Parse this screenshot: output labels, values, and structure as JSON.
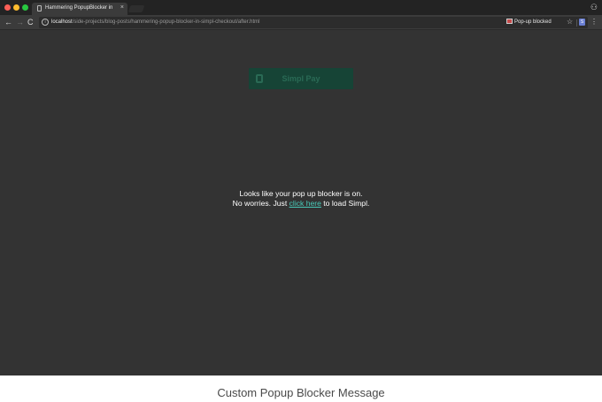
{
  "browser": {
    "tab_title": "Hammering PopupBlocker in S",
    "tab_close": "×",
    "url_host": "localhost",
    "url_path": "/side-projects/blog-posts/hammering-popup-blocker-in-simpl-checkout/after.html",
    "popup_blocked_label": "Pop-up blocked",
    "icons": {
      "back": "←",
      "forward": "→",
      "reload": "C",
      "star": "☆",
      "menu": "⋮",
      "profile": "⚇",
      "info": "i",
      "extension": "S"
    }
  },
  "page": {
    "button_label": "Simpl Pay",
    "message_line_1": "Looks like your pop up blocker is on.",
    "message_prefix": "No worries. Just ",
    "link_text": "click here",
    "message_suffix": " to load Simpl."
  },
  "caption": "Custom Popup Blocker Message",
  "colors": {
    "page_background": "#333333",
    "link": "#48c9b8",
    "button_background": "#164436"
  }
}
